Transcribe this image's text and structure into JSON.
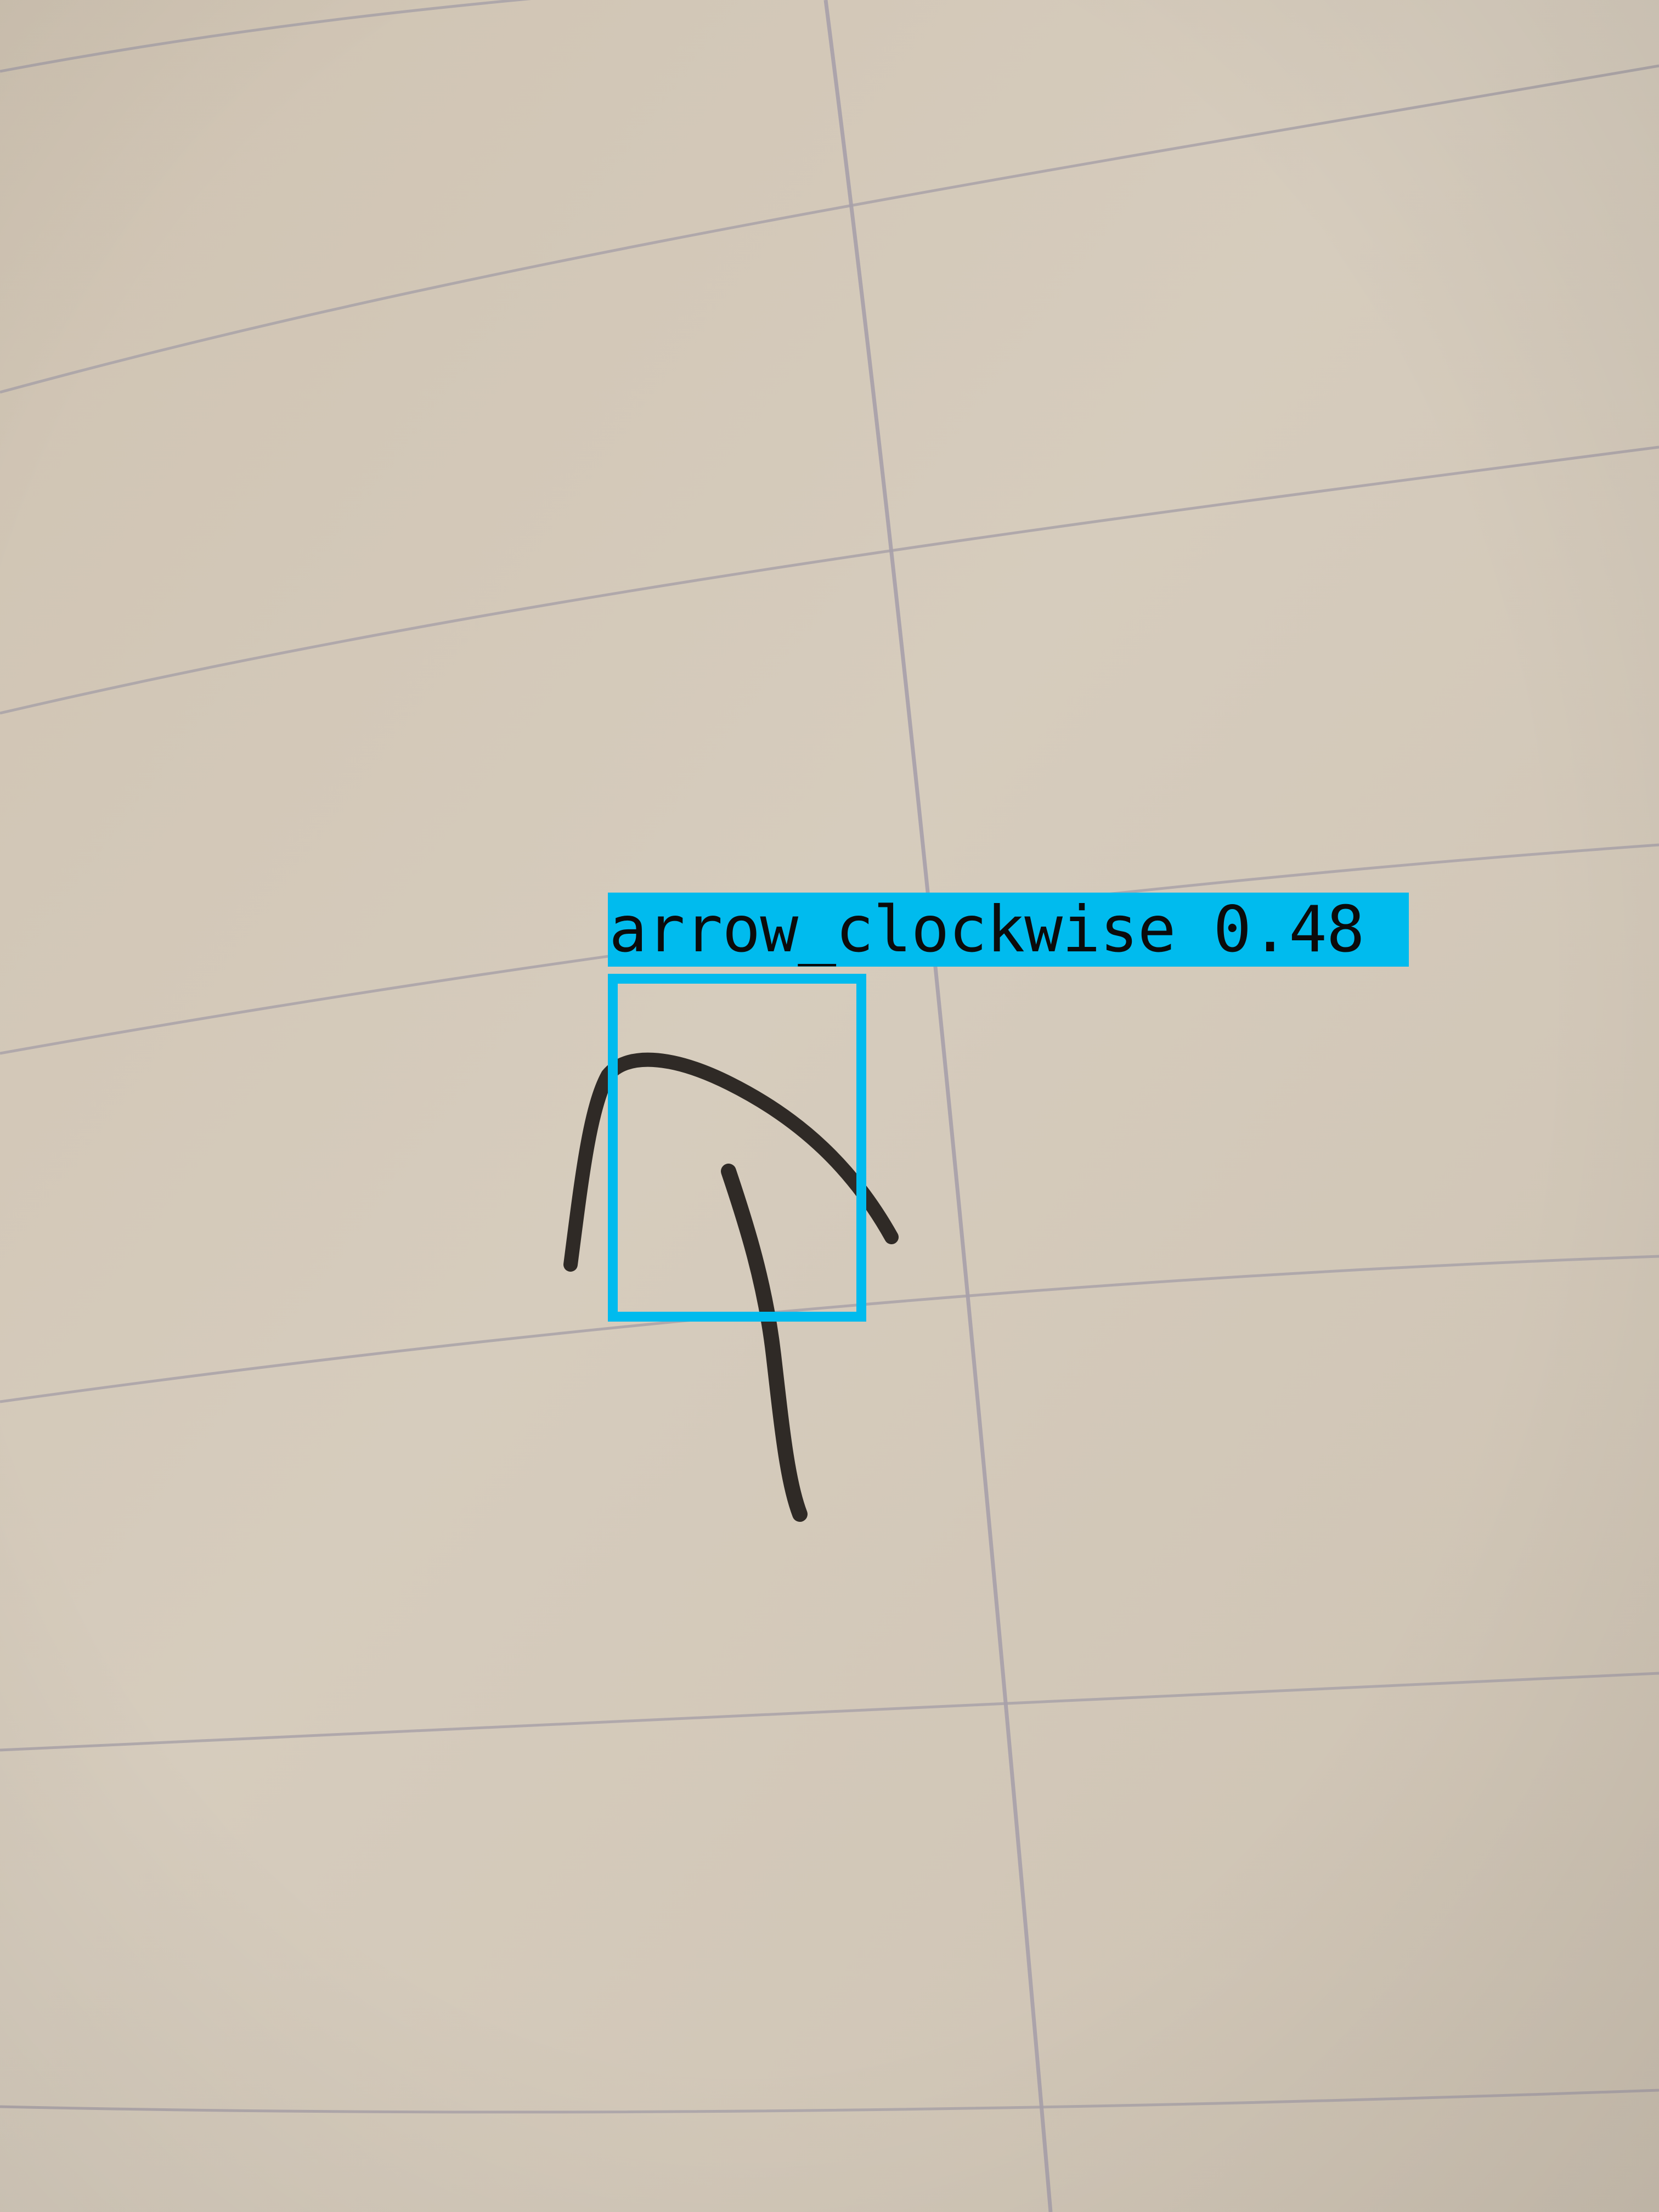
{
  "photo": {
    "subject": "hand-drawn-arrow-on-lined-paper",
    "paper_color": "#d3c8b8",
    "rule_line_color": "#a9a2a8",
    "ink_color": "#2f2a26"
  },
  "detection": {
    "label": "arrow_clockwise 0.48",
    "class_name": "arrow_clockwise",
    "score": 0.48,
    "box_color": "#00bbee"
  }
}
